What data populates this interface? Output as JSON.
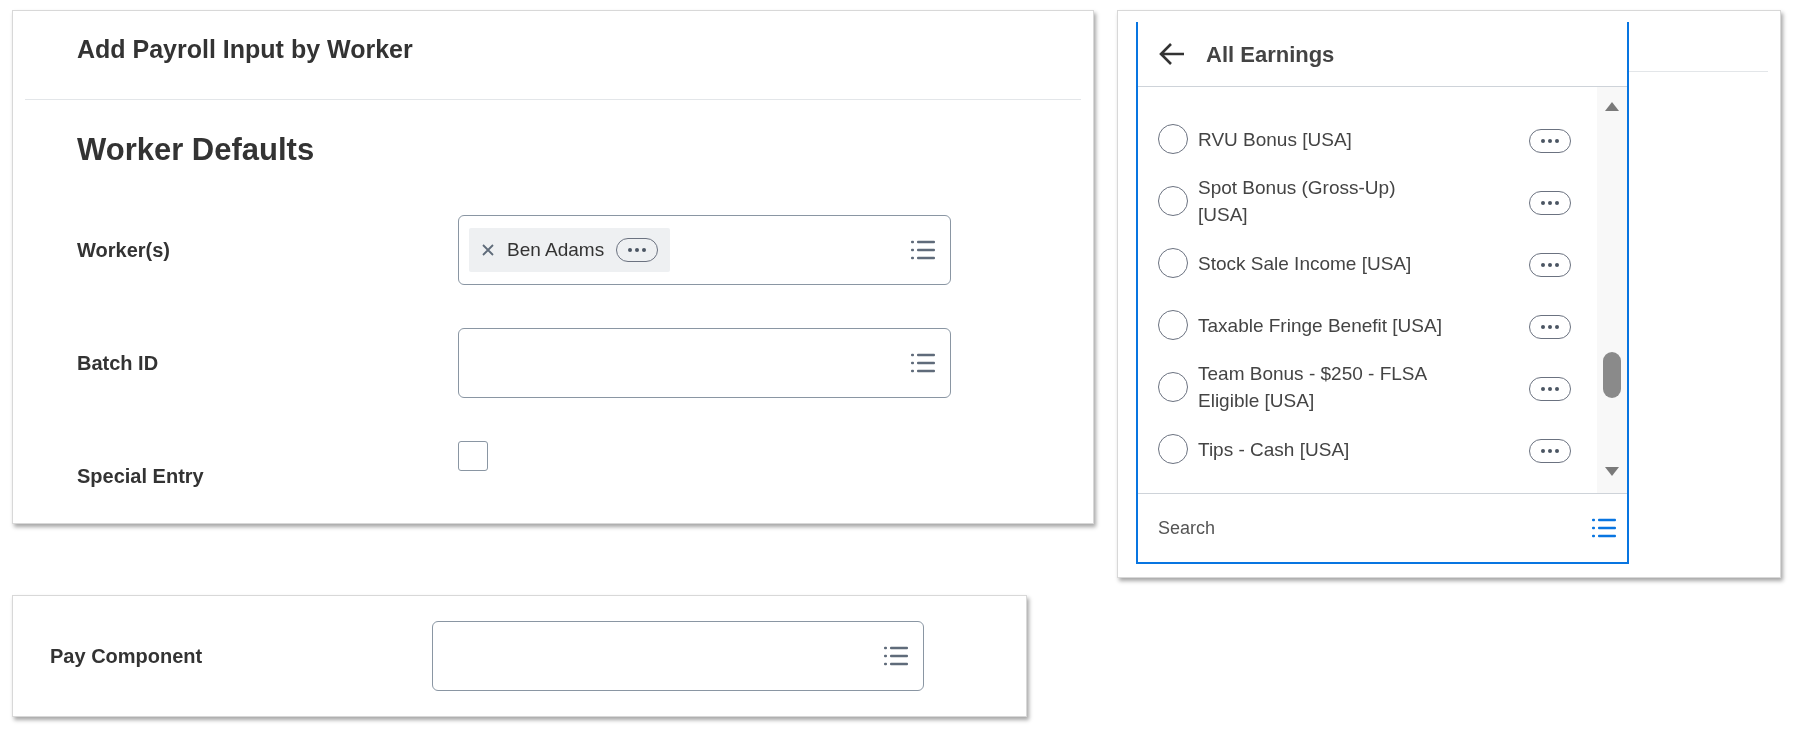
{
  "form": {
    "title": "Add Payroll Input by Worker",
    "section": "Worker Defaults",
    "fields": [
      {
        "label": "Worker(s)",
        "kind": "prompt",
        "tokens": [
          "Ben Adams"
        ]
      },
      {
        "label": "Batch ID",
        "kind": "prompt"
      },
      {
        "label": "Special Entry",
        "kind": "checkbox",
        "checked": false
      }
    ]
  },
  "pay_component": {
    "label": "Pay Component",
    "kind": "prompt"
  },
  "dropdown": {
    "title": "All Earnings",
    "options": [
      {
        "label": "RVU Bonus [USA]",
        "selected": false
      },
      {
        "label": "Spot Bonus (Gross-Up) [USA]",
        "selected": false
      },
      {
        "label": "Stock Sale Income [USA]",
        "selected": false
      },
      {
        "label": "Taxable Fringe Benefit [USA]",
        "selected": false
      },
      {
        "label": "Team Bonus - $250 - FLSA Eligible [USA]",
        "selected": false
      },
      {
        "label": "Tips - Cash [USA]",
        "selected": false
      }
    ],
    "search": {
      "placeholder": "Search"
    }
  }
}
